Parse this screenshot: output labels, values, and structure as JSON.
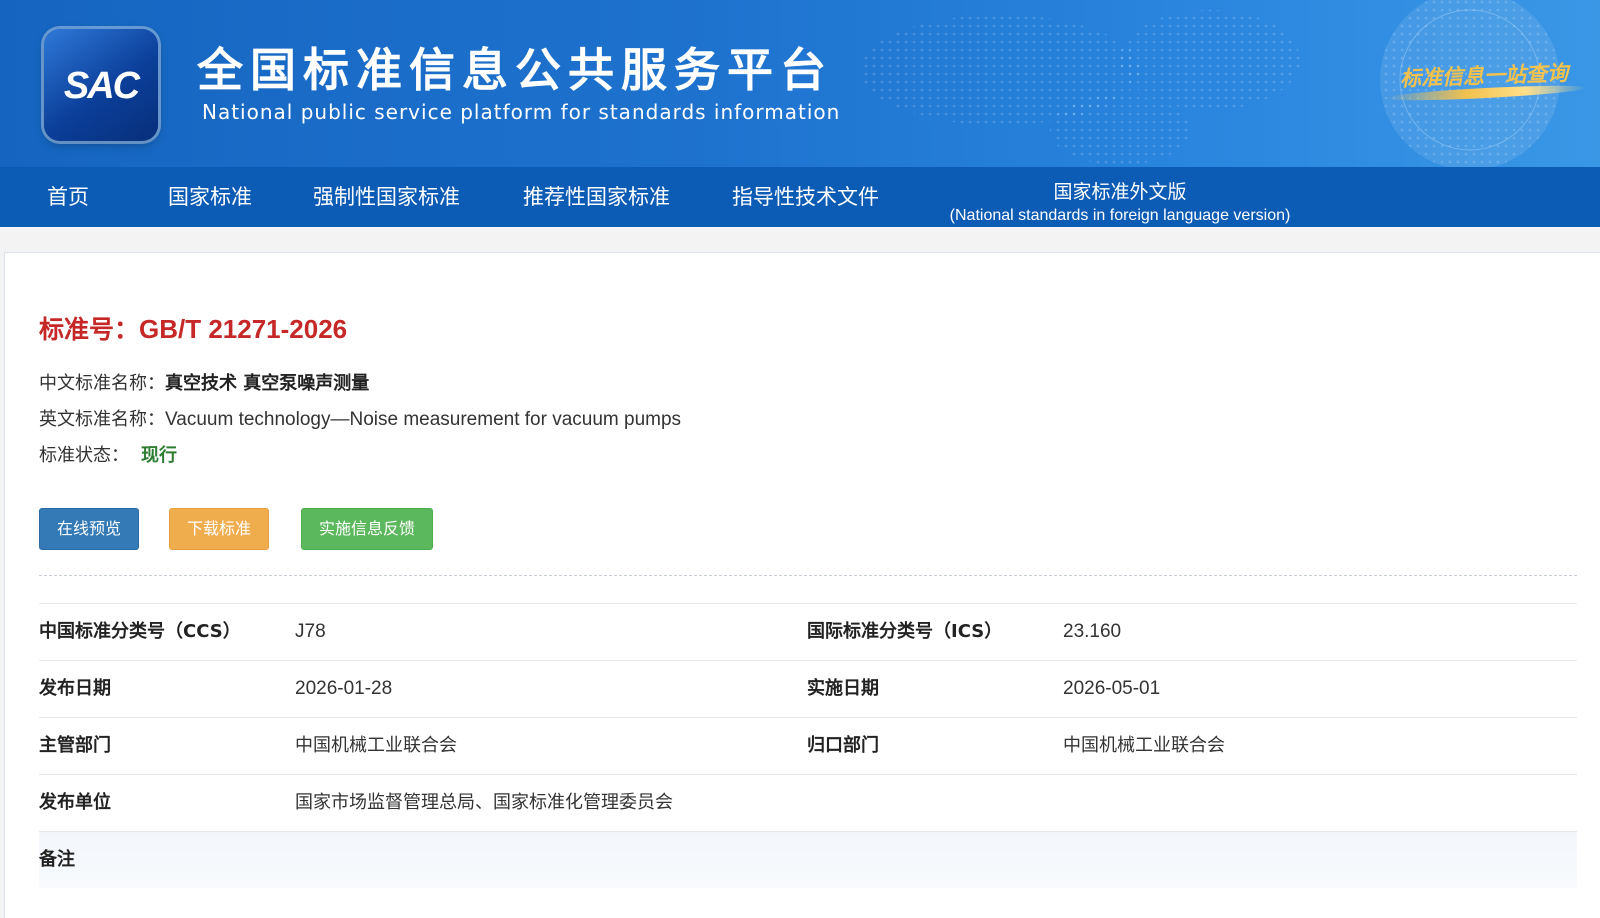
{
  "header": {
    "logo_text": "SAC",
    "title_cn": "全国标准信息公共服务平台",
    "title_en": "National public service platform  for standards information",
    "slogan": "标准信息一站查询"
  },
  "nav": {
    "items": [
      "首页",
      "国家标准",
      "强制性国家标准",
      "推荐性国家标准",
      "指导性技术文件"
    ],
    "foreign": {
      "line1": "国家标准外文版",
      "line2": "(National standards in foreign language version)"
    }
  },
  "standard": {
    "number_label": "标准号：",
    "number_value": "GB/T 21271-2026",
    "cn_name_label": "中文标准名称：",
    "cn_name_value": "真空技术 真空泵噪声测量",
    "en_name_label": "英文标准名称：",
    "en_name_value": "Vacuum technology—Noise measurement for vacuum pumps",
    "status_label": "标准状态：",
    "status_value": "现行"
  },
  "buttons": {
    "preview": "在线预览",
    "download": "下载标准",
    "feedback": "实施信息反馈"
  },
  "details": {
    "ccs_label": "中国标准分类号（CCS）",
    "ccs_value": "J78",
    "ics_label": "国际标准分类号（ICS）",
    "ics_value": "23.160",
    "publish_date_label": "发布日期",
    "publish_date_value": "2026-01-28",
    "effective_date_label": "实施日期",
    "effective_date_value": "2026-05-01",
    "authority_label": "主管部门",
    "authority_value": "中国机械工业联合会",
    "centralized_label": "归口部门",
    "centralized_value": "中国机械工业联合会",
    "issuer_label": "发布单位",
    "issuer_value": "国家市场监督管理总局、国家标准化管理委员会",
    "remark_label": "备注"
  },
  "colors": {
    "header_blue": "#1e73cf",
    "nav_blue": "#0c5bb5",
    "standard_red": "#c62828",
    "status_green": "#2e7d32",
    "btn_blue": "#337ab7",
    "btn_orange": "#f0ad4e",
    "btn_green": "#5cb85c"
  }
}
